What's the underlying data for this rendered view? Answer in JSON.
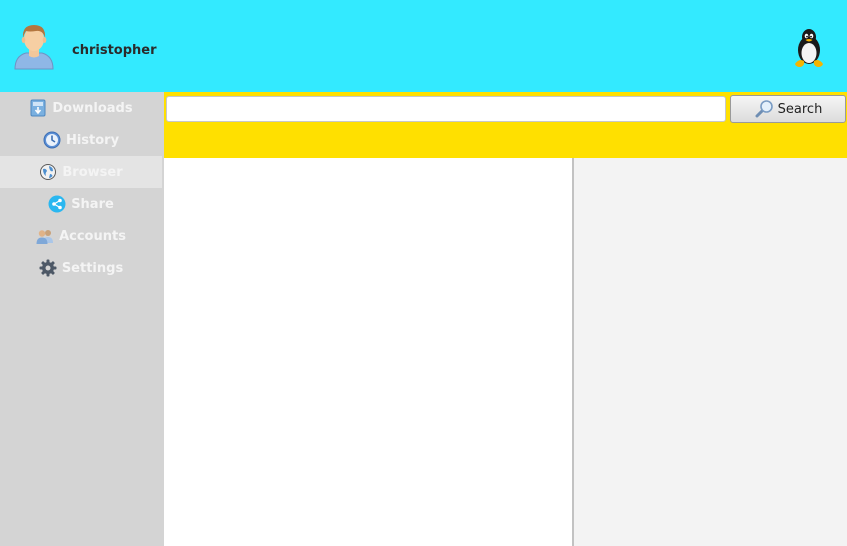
{
  "header": {
    "username": "christopher",
    "avatar_icon": "user-avatar-icon",
    "logo_icon": "tux-penguin-icon",
    "background": "#33eaff"
  },
  "sidebar": {
    "background": "#d4d4d4",
    "active_item": "Browser",
    "items": [
      {
        "label": "Downloads",
        "icon": "downloads-icon"
      },
      {
        "label": "History",
        "icon": "history-clock-icon"
      },
      {
        "label": "Browser",
        "icon": "globe-icon"
      },
      {
        "label": "Share",
        "icon": "share-icon"
      },
      {
        "label": "Accounts",
        "icon": "accounts-icon"
      },
      {
        "label": "Settings",
        "icon": "gear-icon"
      }
    ]
  },
  "toolbar": {
    "background": "#ffe000",
    "search_value": "",
    "search_placeholder": "",
    "search_button_label": "Search",
    "search_button_icon": "magnifier-icon"
  },
  "colors": {
    "main_pane": "#ffffff",
    "side_pane": "#f3f3f3"
  }
}
